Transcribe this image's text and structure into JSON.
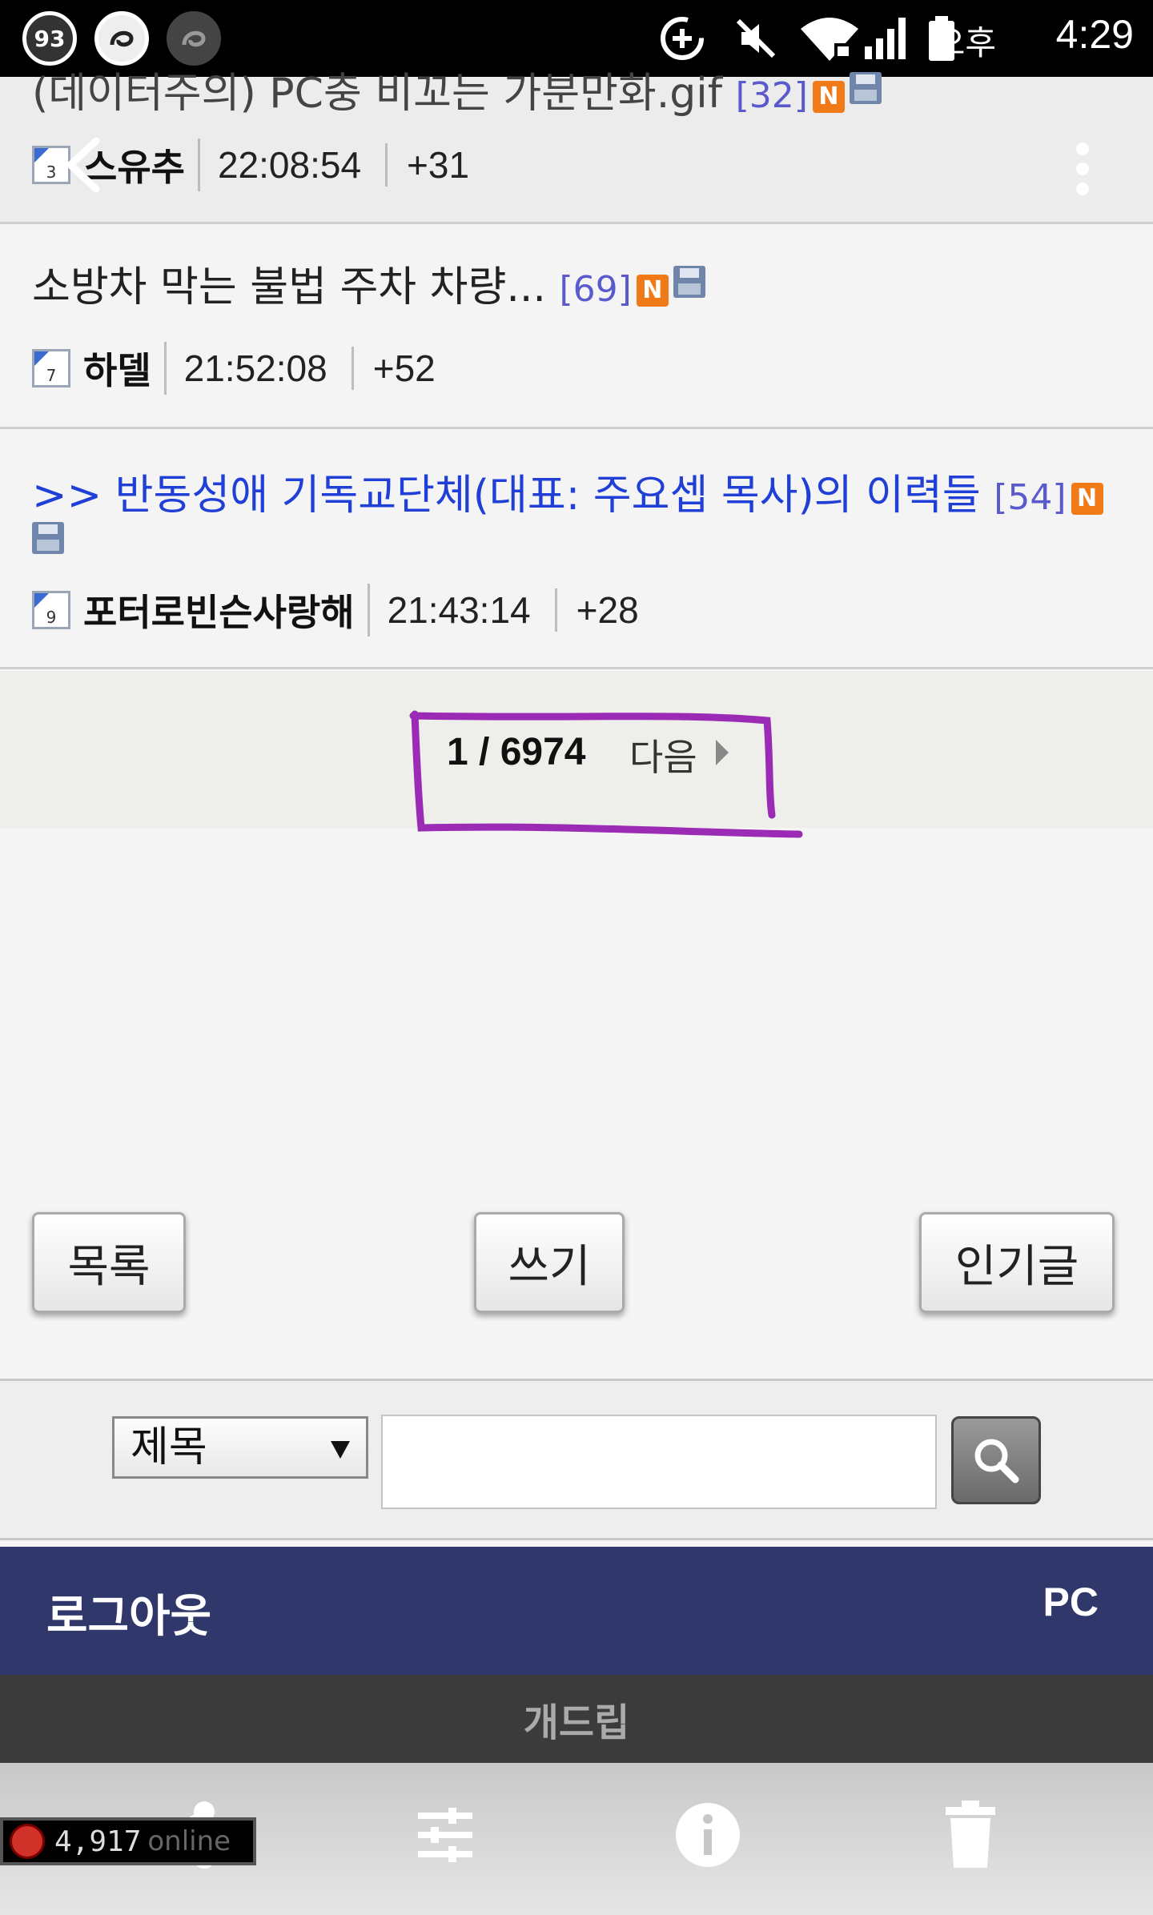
{
  "status_bar": {
    "badge1": "93",
    "ampm": "오후",
    "time": "4:29"
  },
  "posts": [
    {
      "title": "(데이터주의) PC충 비꼬는 가분만화.gif",
      "comment_count": "[32]",
      "author": "스유추",
      "level": "3",
      "time": "22:08:54",
      "score": "+31"
    },
    {
      "title": "소방차 막는 불법 주차 차량...",
      "comment_count": "[69]",
      "author": "하델",
      "level": "7",
      "time": "21:52:08",
      "score": "+52"
    },
    {
      "title": ">> 반동성애 기독교단체(대표: 주요셉 목사)의 이력들",
      "comment_count": "[54]",
      "author": "포터로빈슨사랑해",
      "level": "9",
      "time": "21:43:14",
      "score": "+28"
    }
  ],
  "badge_new": "N",
  "pager": {
    "page": "1 / 6974",
    "next": "다음"
  },
  "buttons": {
    "list": "목록",
    "write": "쓰기",
    "popular": "인기글"
  },
  "search": {
    "field_selected": "제목",
    "query": ""
  },
  "footer": {
    "logout": "로그아웃",
    "pc": "PC",
    "site": "개드립"
  },
  "online": {
    "count": "4,917",
    "label": "online"
  },
  "colors": {
    "link_blue": "#1f3fd6",
    "footer_navy": "#2f376b",
    "annotation_purple": "#9b2bb5"
  }
}
